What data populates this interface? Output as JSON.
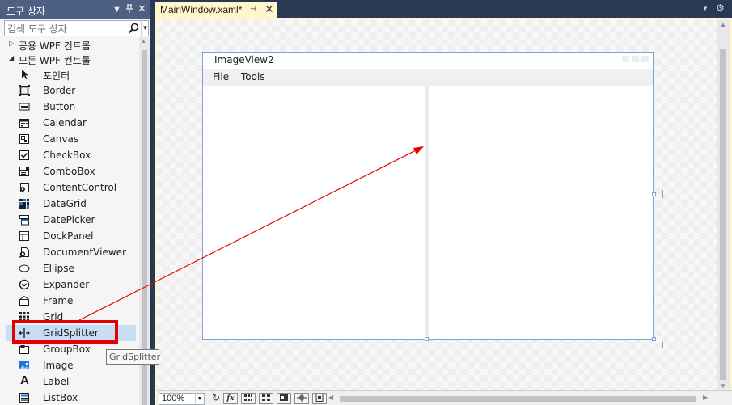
{
  "toolbox": {
    "title": "도구 상자",
    "dropdown_icon": "▼",
    "pin_icon": "ᛘ",
    "close_icon": "✕",
    "search_placeholder": "검색 도구 상자",
    "groups": [
      {
        "label": "공용 WPF 컨트롤",
        "expanded": false
      },
      {
        "label": "모든 WPF 컨트롤",
        "expanded": true
      }
    ],
    "items": [
      {
        "label": "포인터",
        "icon": "pointer-icon"
      },
      {
        "label": "Border",
        "icon": "border-icon"
      },
      {
        "label": "Button",
        "icon": "button-icon"
      },
      {
        "label": "Calendar",
        "icon": "calendar-icon"
      },
      {
        "label": "Canvas",
        "icon": "canvas-icon"
      },
      {
        "label": "CheckBox",
        "icon": "checkbox-icon"
      },
      {
        "label": "ComboBox",
        "icon": "combobox-icon"
      },
      {
        "label": "ContentControl",
        "icon": "contentcontrol-icon"
      },
      {
        "label": "DataGrid",
        "icon": "datagrid-icon"
      },
      {
        "label": "DatePicker",
        "icon": "datepicker-icon"
      },
      {
        "label": "DockPanel",
        "icon": "dockpanel-icon"
      },
      {
        "label": "DocumentViewer",
        "icon": "documentviewer-icon"
      },
      {
        "label": "Ellipse",
        "icon": "ellipse-icon"
      },
      {
        "label": "Expander",
        "icon": "expander-icon"
      },
      {
        "label": "Frame",
        "icon": "frame-icon"
      },
      {
        "label": "Grid",
        "icon": "grid-icon"
      },
      {
        "label": "GridSplitter",
        "icon": "gridsplitter-icon",
        "selected": true
      },
      {
        "label": "GroupBox",
        "icon": "groupbox-icon"
      },
      {
        "label": "Image",
        "icon": "image-icon"
      },
      {
        "label": "Label",
        "icon": "label-icon"
      },
      {
        "label": "ListBox",
        "icon": "listbox-icon"
      }
    ],
    "tooltip": "GridSplitter"
  },
  "document": {
    "tab_label": "MainWindow.xaml*",
    "tab_pin_icon": "⊣",
    "tab_close_icon": "✕",
    "tab_menu_icon": "▼",
    "settings_icon": "⚙"
  },
  "design_window": {
    "title": "ImageView2",
    "menu": [
      "File",
      "Tools"
    ]
  },
  "bottombar": {
    "zoom": "100%",
    "formula_label": "fx"
  },
  "colors": {
    "accent": "#293955",
    "highlight_border": "#e30000",
    "arrow": "#e30000",
    "selection": "#c9def5"
  }
}
